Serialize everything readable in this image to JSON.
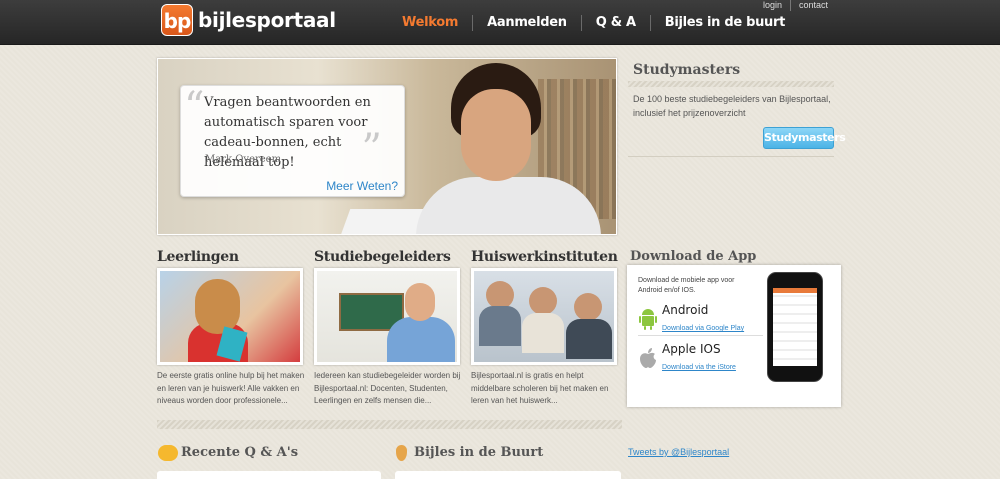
{
  "header": {
    "logo_badge": "bp",
    "logo_text": "bijlesportaal",
    "nav": [
      "Welkom",
      "Aanmelden",
      "Q & A",
      "Bijles in de buurt"
    ],
    "top_links": [
      "login",
      "contact"
    ],
    "accent": "#f47a30"
  },
  "hero": {
    "quote": "Vragen beantwoorden en automatisch sparen voor cadeau-bonnen, echt helemaal top!",
    "author": "Mark Overeem",
    "more_link": "Meer Weten?"
  },
  "studymasters": {
    "title": "Studymasters",
    "text": "De 100 beste studiebegeleiders van Bijlesportaal, inclusief het prijzenoverzicht",
    "button": "Studymasters"
  },
  "columns": [
    {
      "title": "Leerlingen",
      "text": "De eerste gratis online hulp bij het maken en leren van je huiswerk! Alle vakken en niveaus worden door professionele..."
    },
    {
      "title": "Studiebegeleiders",
      "text": "Iedereen kan studiebegeleider worden bij Bijlesportaal.nl: Docenten, Studenten, Leerlingen en zelfs mensen die..."
    },
    {
      "title": "Huiswerkinstituten",
      "text": "Bijlesportaal.nl is gratis en helpt middelbare scholeren bij het maken en leren van het huiswerk..."
    }
  ],
  "app": {
    "title": "Download de App",
    "intro": "Download de mobiele app voor Android en/of IOS.",
    "android_name": "Android",
    "android_link": "Download via Google Play",
    "ios_name": "Apple IOS",
    "ios_link": "Download via the iStore"
  },
  "bottom": {
    "qa_title": "Recente Q & A's",
    "buurt_title": "Bijles in de Buurt",
    "tweets": "Tweets by @Bijlesportaal"
  }
}
